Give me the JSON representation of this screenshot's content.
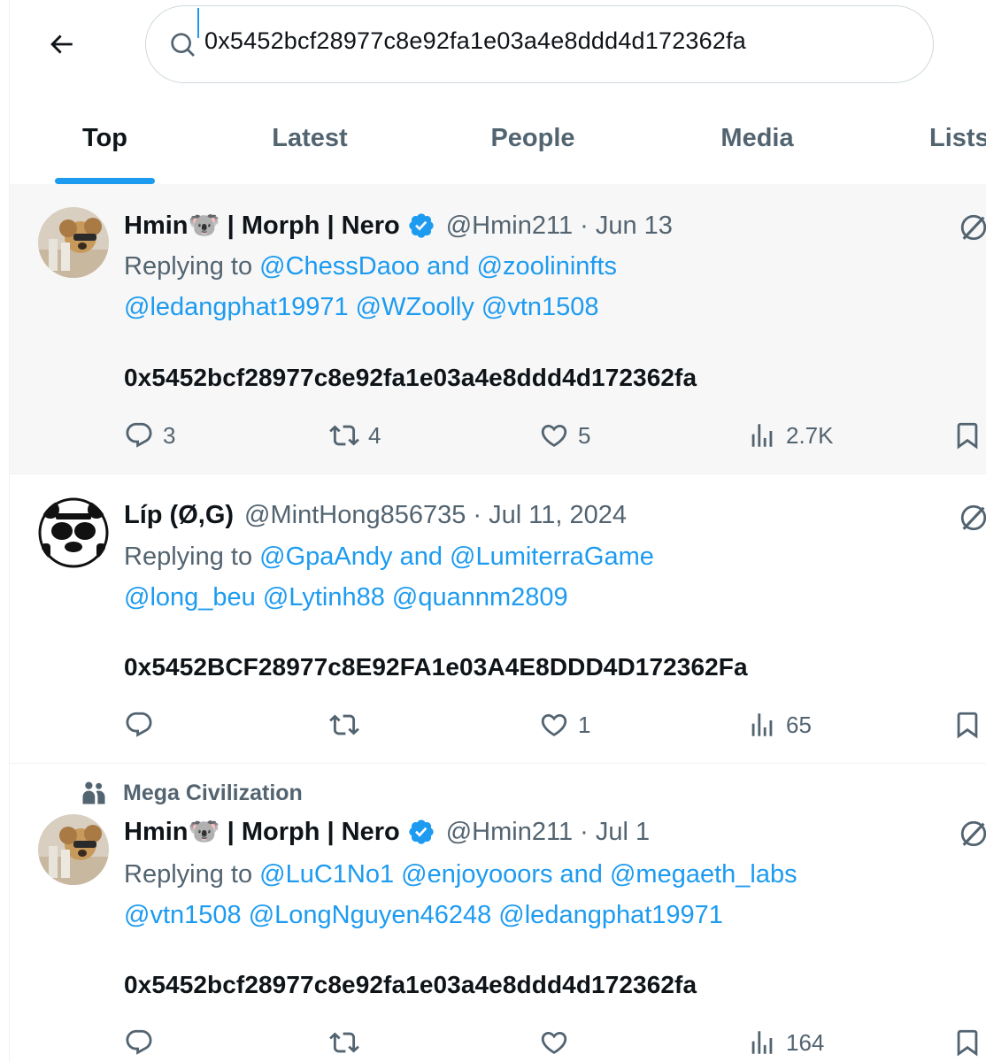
{
  "search": {
    "query": "0x5452bcf28977c8e92fa1e03a4e8ddd4d172362fa"
  },
  "tabs": [
    {
      "label": "Top",
      "active": true
    },
    {
      "label": "Latest",
      "active": false
    },
    {
      "label": "People",
      "active": false
    },
    {
      "label": "Media",
      "active": false
    },
    {
      "label": "Lists",
      "active": false
    }
  ],
  "colors": {
    "accent": "#1d9bf0",
    "text_primary": "#0f1419",
    "text_secondary": "#536471",
    "highlight_bg": "#f7f7f7"
  },
  "tweets": [
    {
      "display_name": "Hmin🐨 | Morph | Nero",
      "verified": true,
      "handle_time": "@Hmin211 · Jun 13",
      "reply_prefix": "Replying to ",
      "reply_line1": "@ChessDaoo and @zoolininfts",
      "reply_line2": "@ledangphat19971 @WZoolly @vtn1508",
      "text": "0x5452bcf28977c8e92fa1e03a4e8ddd4d172362fa",
      "replies": "3",
      "retweets": "4",
      "likes": "5",
      "views": "2.7K"
    },
    {
      "display_name": "Líp (Ø,G)",
      "verified": false,
      "handle_time": "@MintHong856735 · Jul 11, 2024",
      "reply_prefix": "Replying to ",
      "reply_line1": "@GpaAndy and @LumiterraGame",
      "reply_line2": "@long_beu @Lytinh88 @quannm2809",
      "text": "0x5452BCF28977c8E92FA1e03A4E8DDD4D172362Fa",
      "replies": "",
      "retweets": "",
      "likes": "1",
      "views": "65"
    },
    {
      "social_context": "Mega Civilization",
      "display_name": "Hmin🐨 | Morph | Nero",
      "verified": true,
      "handle_time": "@Hmin211 · Jul 1",
      "reply_prefix": "Replying to ",
      "reply_line1": "@LuC1No1 @enjoyooors and @megaeth_labs",
      "reply_line2": "@vtn1508 @LongNguyen46248 @ledangphat19971",
      "text": "0x5452bcf28977c8e92fa1e03a4e8ddd4d172362fa",
      "replies": "",
      "retweets": "",
      "likes": "",
      "views": "164"
    }
  ]
}
